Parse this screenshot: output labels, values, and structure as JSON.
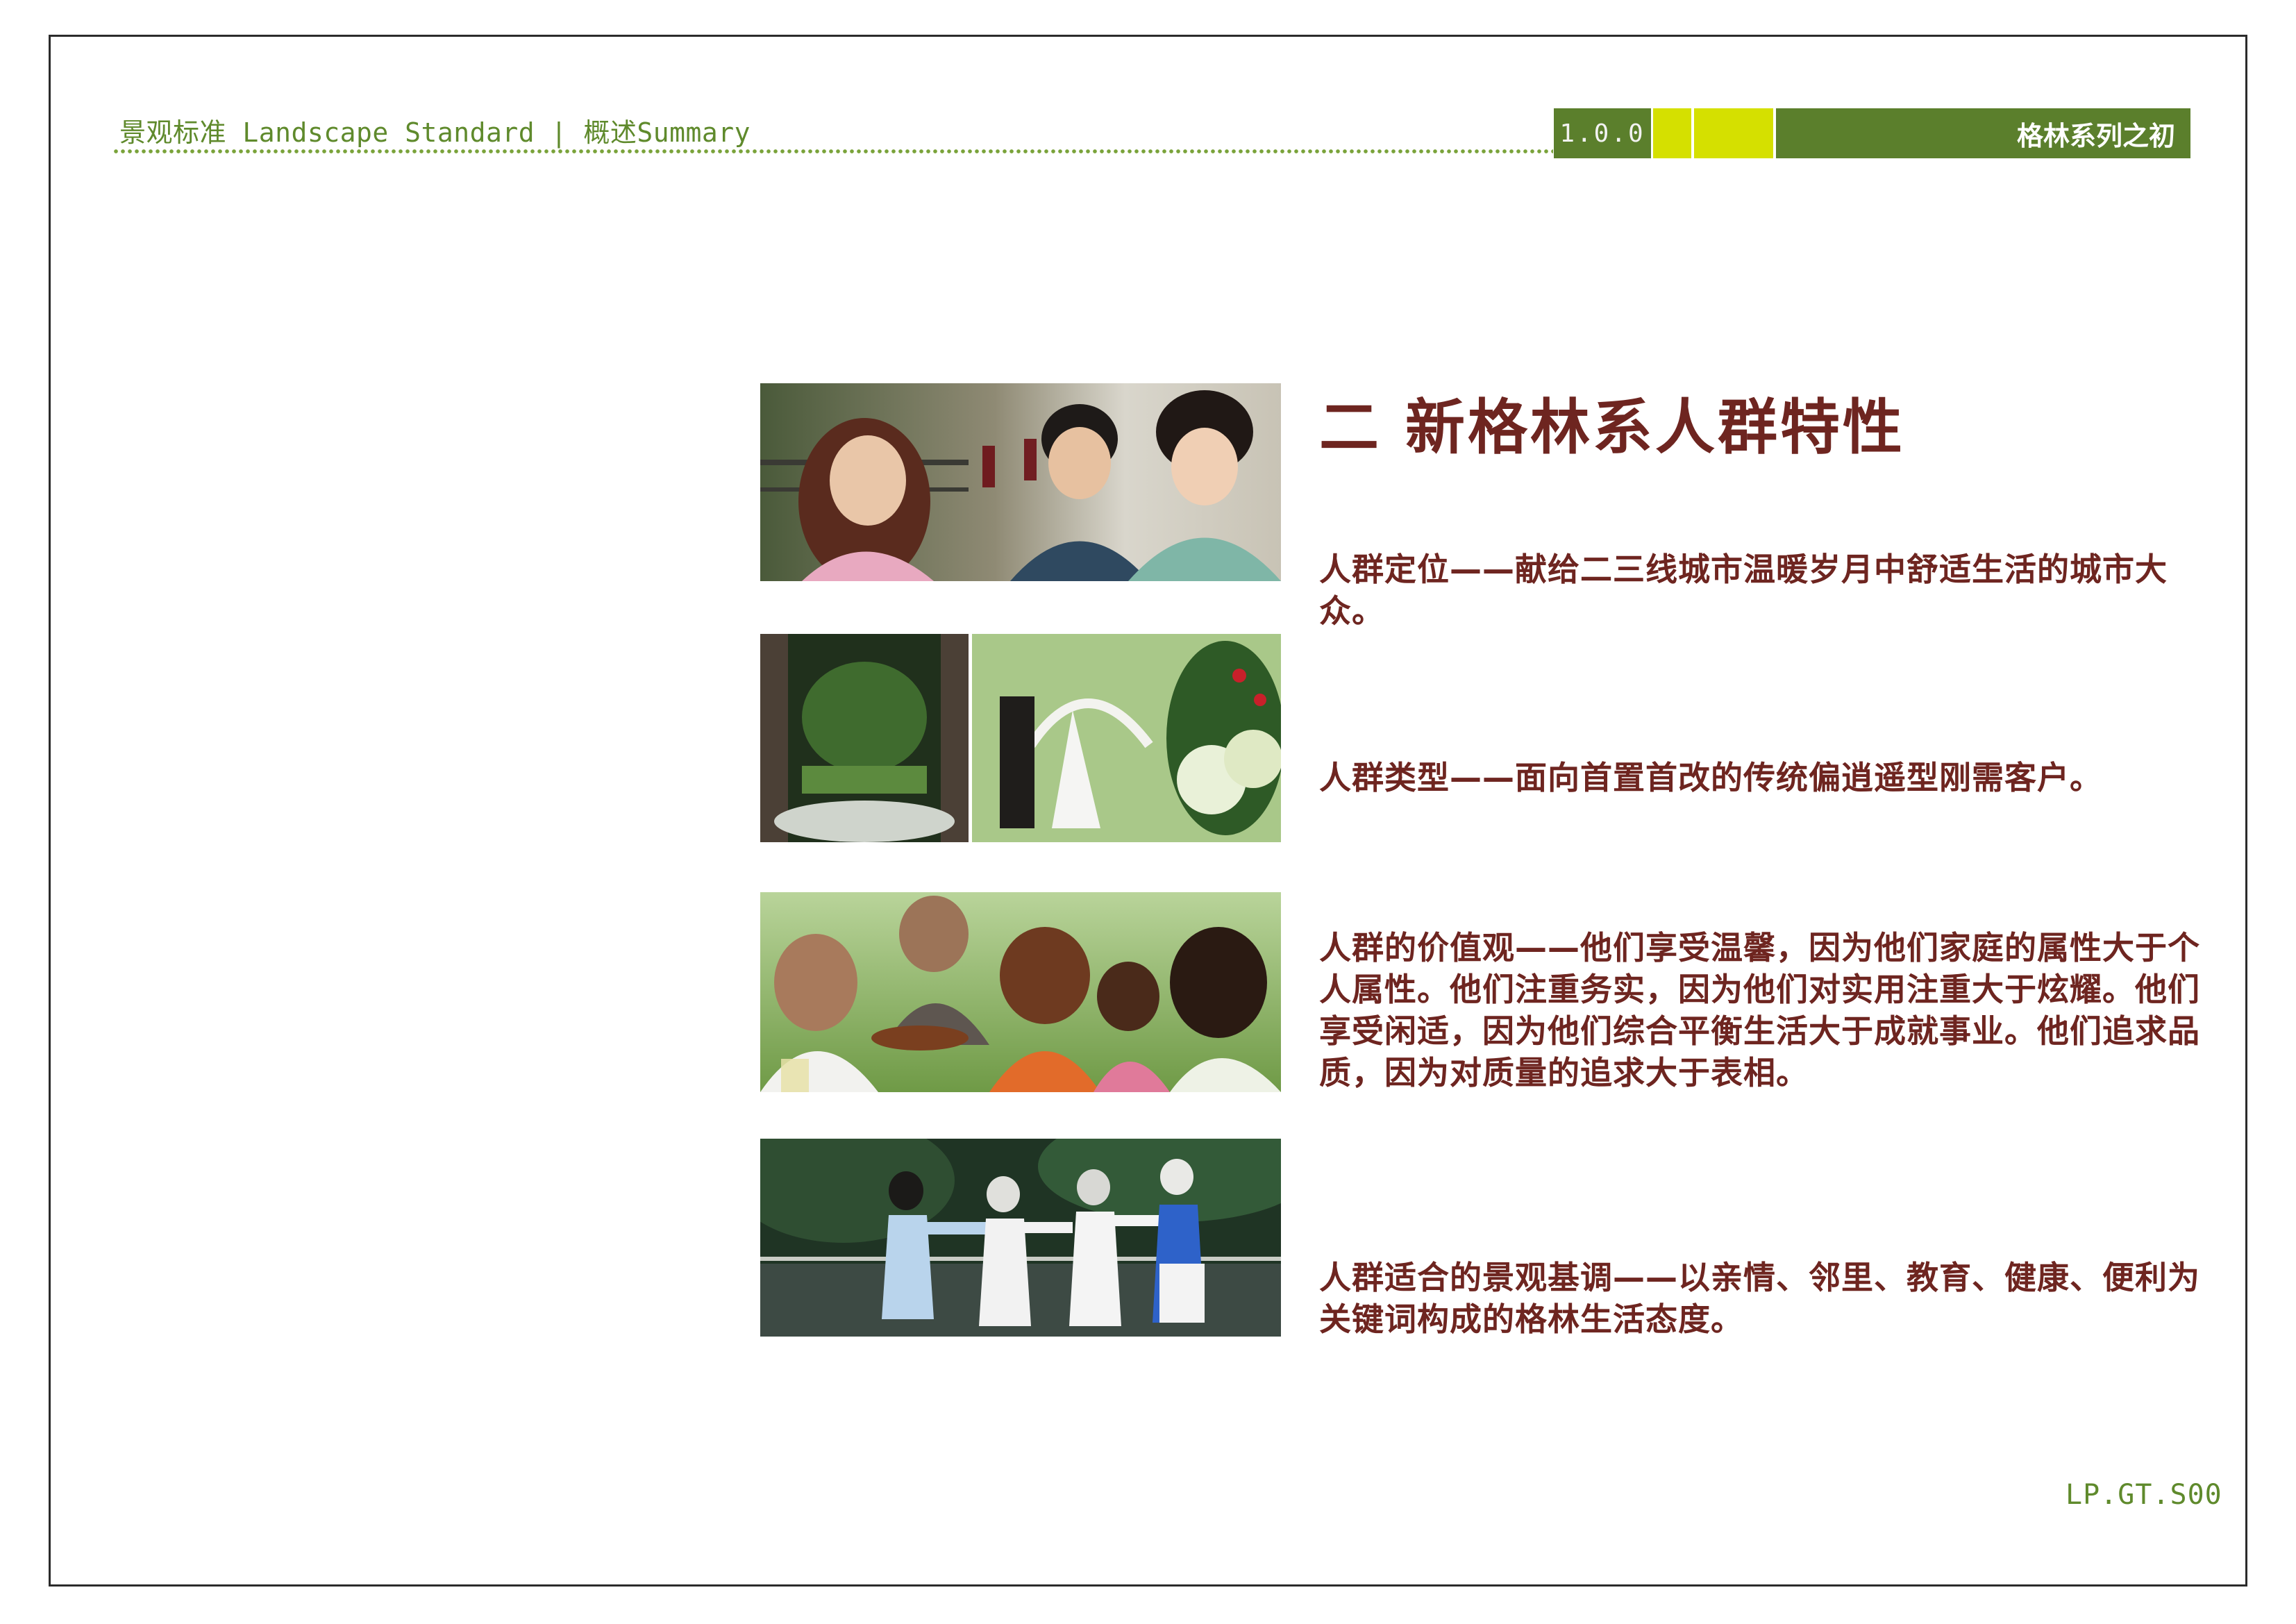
{
  "header": {
    "title": "景观标准 Landscape Standard | 概述Summary",
    "version": "1.0.0",
    "series": "格林系列之初"
  },
  "section": {
    "title": "二 新格林系人群特性"
  },
  "paragraphs": [
    "人群定位——献给二三线城市温暖岁月中舒适生活的城市大众。",
    "人群类型——面向首置首改的传统偏逍遥型刚需客户。",
    "人群的价值观——他们享受温馨，因为他们家庭的属性大于个人属性。他们注重务实，因为他们对实用注重大于炫耀。他们享受闲适，因为他们综合平衡生活大于成就事业。他们追求品质，因为对质量的追求大于表相。",
    "人群适合的景观基调——以亲情、邻里、教育、健康、便利为关键词构成的格林生活态度。"
  ],
  "footer": {
    "page_code": "LP.GT.S00"
  },
  "colors": {
    "brand_green": "#5b7f2c",
    "accent_yellow": "#d5e000",
    "text_maroon": "#6e2520"
  }
}
